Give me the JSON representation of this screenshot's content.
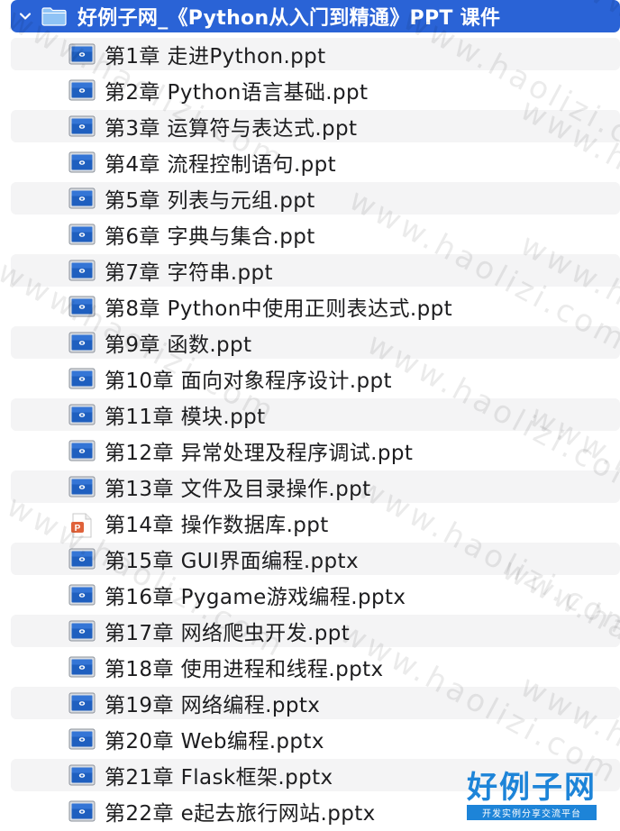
{
  "folder": {
    "title": "好例子网_《Python从入门到精通》PPT 课件",
    "expanded_icon": "chevron-down-icon",
    "icon": "folder-icon"
  },
  "files": [
    {
      "name": "第1章  走进Python.ppt",
      "type": "keynote"
    },
    {
      "name": "第2章  Python语言基础.ppt",
      "type": "keynote"
    },
    {
      "name": "第3章  运算符与表达式.ppt",
      "type": "keynote"
    },
    {
      "name": "第4章  流程控制语句.ppt",
      "type": "keynote"
    },
    {
      "name": "第5章  列表与元组.ppt",
      "type": "keynote"
    },
    {
      "name": "第6章  字典与集合.ppt",
      "type": "keynote"
    },
    {
      "name": "第7章  字符串.ppt",
      "type": "keynote"
    },
    {
      "name": "第8章  Python中使用正则表达式.ppt",
      "type": "keynote"
    },
    {
      "name": "第9章  函数.ppt",
      "type": "keynote"
    },
    {
      "name": "第10章  面向对象程序设计.ppt",
      "type": "keynote"
    },
    {
      "name": "第11章  模块.ppt",
      "type": "keynote"
    },
    {
      "name": "第12章  异常处理及程序调试.ppt",
      "type": "keynote"
    },
    {
      "name": "第13章  文件及目录操作.ppt",
      "type": "keynote"
    },
    {
      "name": "第14章  操作数据库.ppt",
      "type": "powerpoint"
    },
    {
      "name": "第15章  GUI界面编程.pptx",
      "type": "keynote"
    },
    {
      "name": "第16章 Pygame游戏编程.pptx",
      "type": "keynote"
    },
    {
      "name": "第17章  网络爬虫开发.ppt",
      "type": "keynote"
    },
    {
      "name": "第18章  使用进程和线程.pptx",
      "type": "keynote"
    },
    {
      "name": "第19章  网络编程.pptx",
      "type": "keynote"
    },
    {
      "name": "第20章  Web编程.pptx",
      "type": "keynote"
    },
    {
      "name": "第21章  Flask框架.pptx",
      "type": "keynote"
    },
    {
      "name": "第22章  e起去旅行网站.pptx",
      "type": "keynote"
    }
  ],
  "watermark": {
    "text": "www.haolizi.com"
  },
  "logo": {
    "main": "好例子网",
    "sub": "开发实例分享交流平台"
  },
  "colors": {
    "selection": "#2a63d6",
    "stripe": "#f4f4f5",
    "keynote_blue": "#1f5fbf",
    "powerpoint_orange": "#e0623a",
    "logo_blue": "#1d84d8"
  }
}
